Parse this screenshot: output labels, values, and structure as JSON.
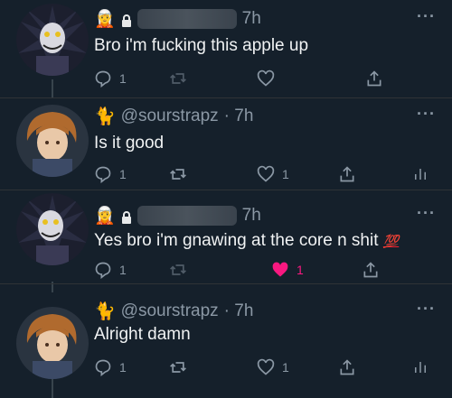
{
  "tweets": [
    {
      "handle": "",
      "time": "7h",
      "text": "Bro i'm fucking this apple up",
      "reply_count": "1",
      "retweet_count": "",
      "like_count": "",
      "liked": false,
      "header_emoji": "🧝",
      "avatar": "ryuk-avatar",
      "locked": true
    },
    {
      "handle": "@sourstrapz",
      "time": "· 7h",
      "text": "Is it good",
      "reply_count": "1",
      "retweet_count": "",
      "like_count": "1",
      "liked": false,
      "header_emoji": "🐈",
      "avatar": "light-avatar",
      "locked": false
    },
    {
      "handle": "",
      "time": "7h",
      "text": "Yes bro i'm gnawing at the core n shit",
      "text_emoji": "💯",
      "reply_count": "1",
      "retweet_count": "",
      "like_count": "1",
      "liked": true,
      "header_emoji": "🧝",
      "avatar": "ryuk-avatar",
      "locked": true
    },
    {
      "handle": "@sourstrapz",
      "time": "· 7h",
      "text": "Alright damn",
      "reply_count": "1",
      "retweet_count": "",
      "like_count": "1",
      "liked": false,
      "header_emoji": "🐈",
      "avatar": "light-avatar",
      "locked": false
    }
  ],
  "more_label": "···",
  "colors": {
    "background": "#15202b",
    "text": "#e7e9ea",
    "muted": "#8b98a5",
    "like": "#f91880"
  }
}
